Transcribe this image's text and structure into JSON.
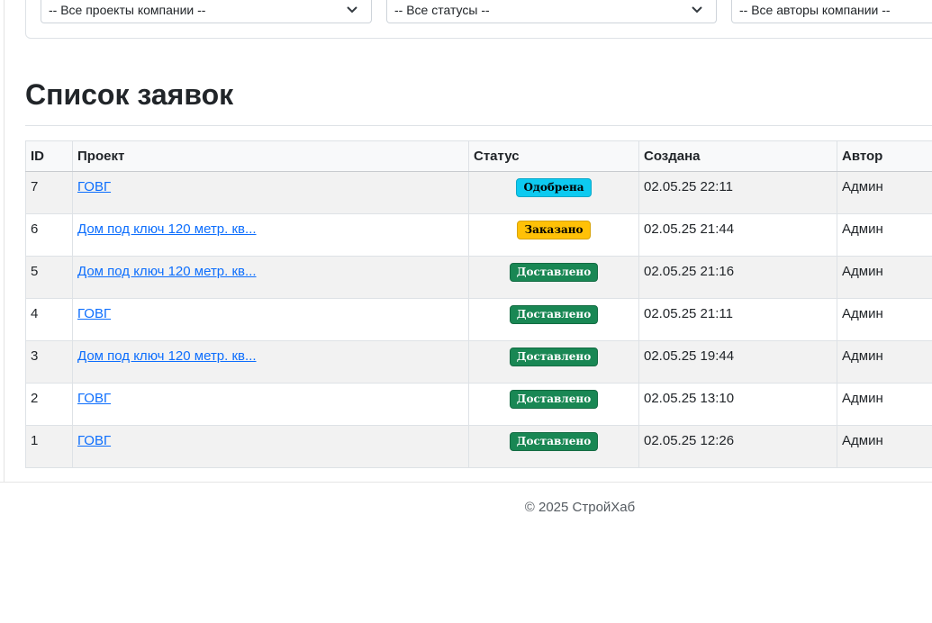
{
  "filters": {
    "projects": "-- Все проекты компании --",
    "statuses": "-- Все статусы --",
    "authors": "-- Все авторы компании --"
  },
  "page_title": "Список заявок",
  "table": {
    "headers": [
      "ID",
      "Проект",
      "Статус",
      "Создана",
      "Автор"
    ],
    "rows": [
      {
        "id": "7",
        "project": "ГОВГ",
        "status": "Одобрена",
        "status_kind": "approved",
        "created": "02.05.25 22:11",
        "author": "Админ"
      },
      {
        "id": "6",
        "project": "Дом под ключ 120 метр. кв...",
        "status": "Заказано",
        "status_kind": "ordered",
        "created": "02.05.25 21:44",
        "author": "Админ"
      },
      {
        "id": "5",
        "project": "Дом под ключ 120 метр. кв...",
        "status": "Доставлено",
        "status_kind": "delivered",
        "created": "02.05.25 21:16",
        "author": "Админ"
      },
      {
        "id": "4",
        "project": "ГОВГ",
        "status": "Доставлено",
        "status_kind": "delivered",
        "created": "02.05.25 21:11",
        "author": "Админ"
      },
      {
        "id": "3",
        "project": "Дом под ключ 120 метр. кв...",
        "status": "Доставлено",
        "status_kind": "delivered",
        "created": "02.05.25 19:44",
        "author": "Админ"
      },
      {
        "id": "2",
        "project": "ГОВГ",
        "status": "Доставлено",
        "status_kind": "delivered",
        "created": "02.05.25 13:10",
        "author": "Админ"
      },
      {
        "id": "1",
        "project": "ГОВГ",
        "status": "Доставлено",
        "status_kind": "delivered",
        "created": "02.05.25 12:26",
        "author": "Админ"
      }
    ]
  },
  "footer": {
    "text": "© 2025 СтройХаб"
  },
  "colors": {
    "approved": "#0dcaf0",
    "ordered": "#ffc107",
    "delivered": "#198754",
    "link": "#0d6efd"
  },
  "icons": {
    "select_arrow": "chevron-down-icon"
  }
}
